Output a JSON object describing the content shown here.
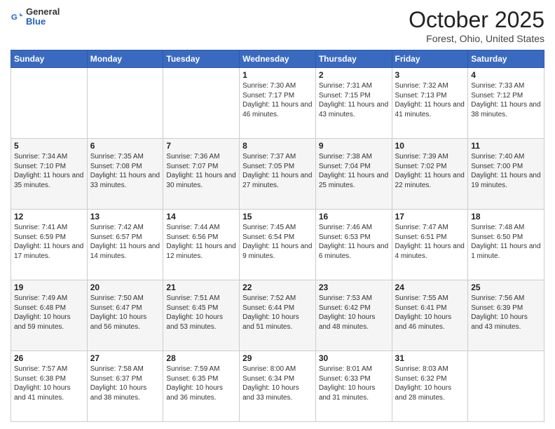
{
  "header": {
    "logo_general": "General",
    "logo_blue": "Blue",
    "month_title": "October 2025",
    "location": "Forest, Ohio, United States"
  },
  "days_of_week": [
    "Sunday",
    "Monday",
    "Tuesday",
    "Wednesday",
    "Thursday",
    "Friday",
    "Saturday"
  ],
  "weeks": [
    [
      {
        "day": "",
        "info": ""
      },
      {
        "day": "",
        "info": ""
      },
      {
        "day": "",
        "info": ""
      },
      {
        "day": "1",
        "info": "Sunrise: 7:30 AM\nSunset: 7:17 PM\nDaylight: 11 hours\nand 46 minutes."
      },
      {
        "day": "2",
        "info": "Sunrise: 7:31 AM\nSunset: 7:15 PM\nDaylight: 11 hours\nand 43 minutes."
      },
      {
        "day": "3",
        "info": "Sunrise: 7:32 AM\nSunset: 7:13 PM\nDaylight: 11 hours\nand 41 minutes."
      },
      {
        "day": "4",
        "info": "Sunrise: 7:33 AM\nSunset: 7:12 PM\nDaylight: 11 hours\nand 38 minutes."
      }
    ],
    [
      {
        "day": "5",
        "info": "Sunrise: 7:34 AM\nSunset: 7:10 PM\nDaylight: 11 hours\nand 35 minutes."
      },
      {
        "day": "6",
        "info": "Sunrise: 7:35 AM\nSunset: 7:08 PM\nDaylight: 11 hours\nand 33 minutes."
      },
      {
        "day": "7",
        "info": "Sunrise: 7:36 AM\nSunset: 7:07 PM\nDaylight: 11 hours\nand 30 minutes."
      },
      {
        "day": "8",
        "info": "Sunrise: 7:37 AM\nSunset: 7:05 PM\nDaylight: 11 hours\nand 27 minutes."
      },
      {
        "day": "9",
        "info": "Sunrise: 7:38 AM\nSunset: 7:04 PM\nDaylight: 11 hours\nand 25 minutes."
      },
      {
        "day": "10",
        "info": "Sunrise: 7:39 AM\nSunset: 7:02 PM\nDaylight: 11 hours\nand 22 minutes."
      },
      {
        "day": "11",
        "info": "Sunrise: 7:40 AM\nSunset: 7:00 PM\nDaylight: 11 hours\nand 19 minutes."
      }
    ],
    [
      {
        "day": "12",
        "info": "Sunrise: 7:41 AM\nSunset: 6:59 PM\nDaylight: 11 hours\nand 17 minutes."
      },
      {
        "day": "13",
        "info": "Sunrise: 7:42 AM\nSunset: 6:57 PM\nDaylight: 11 hours\nand 14 minutes."
      },
      {
        "day": "14",
        "info": "Sunrise: 7:44 AM\nSunset: 6:56 PM\nDaylight: 11 hours\nand 12 minutes."
      },
      {
        "day": "15",
        "info": "Sunrise: 7:45 AM\nSunset: 6:54 PM\nDaylight: 11 hours\nand 9 minutes."
      },
      {
        "day": "16",
        "info": "Sunrise: 7:46 AM\nSunset: 6:53 PM\nDaylight: 11 hours\nand 6 minutes."
      },
      {
        "day": "17",
        "info": "Sunrise: 7:47 AM\nSunset: 6:51 PM\nDaylight: 11 hours\nand 4 minutes."
      },
      {
        "day": "18",
        "info": "Sunrise: 7:48 AM\nSunset: 6:50 PM\nDaylight: 11 hours\nand 1 minute."
      }
    ],
    [
      {
        "day": "19",
        "info": "Sunrise: 7:49 AM\nSunset: 6:48 PM\nDaylight: 10 hours\nand 59 minutes."
      },
      {
        "day": "20",
        "info": "Sunrise: 7:50 AM\nSunset: 6:47 PM\nDaylight: 10 hours\nand 56 minutes."
      },
      {
        "day": "21",
        "info": "Sunrise: 7:51 AM\nSunset: 6:45 PM\nDaylight: 10 hours\nand 53 minutes."
      },
      {
        "day": "22",
        "info": "Sunrise: 7:52 AM\nSunset: 6:44 PM\nDaylight: 10 hours\nand 51 minutes."
      },
      {
        "day": "23",
        "info": "Sunrise: 7:53 AM\nSunset: 6:42 PM\nDaylight: 10 hours\nand 48 minutes."
      },
      {
        "day": "24",
        "info": "Sunrise: 7:55 AM\nSunset: 6:41 PM\nDaylight: 10 hours\nand 46 minutes."
      },
      {
        "day": "25",
        "info": "Sunrise: 7:56 AM\nSunset: 6:39 PM\nDaylight: 10 hours\nand 43 minutes."
      }
    ],
    [
      {
        "day": "26",
        "info": "Sunrise: 7:57 AM\nSunset: 6:38 PM\nDaylight: 10 hours\nand 41 minutes."
      },
      {
        "day": "27",
        "info": "Sunrise: 7:58 AM\nSunset: 6:37 PM\nDaylight: 10 hours\nand 38 minutes."
      },
      {
        "day": "28",
        "info": "Sunrise: 7:59 AM\nSunset: 6:35 PM\nDaylight: 10 hours\nand 36 minutes."
      },
      {
        "day": "29",
        "info": "Sunrise: 8:00 AM\nSunset: 6:34 PM\nDaylight: 10 hours\nand 33 minutes."
      },
      {
        "day": "30",
        "info": "Sunrise: 8:01 AM\nSunset: 6:33 PM\nDaylight: 10 hours\nand 31 minutes."
      },
      {
        "day": "31",
        "info": "Sunrise: 8:03 AM\nSunset: 6:32 PM\nDaylight: 10 hours\nand 28 minutes."
      },
      {
        "day": "",
        "info": ""
      }
    ]
  ]
}
